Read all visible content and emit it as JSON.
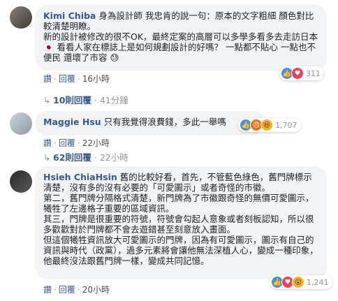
{
  "comments": [
    {
      "author": "Kimi Chiba",
      "text": "身為設計師 我忠肯的說一句：原本的文字粗細 顏色對比較清楚明瞭。\n新的設計被修改的很不OK，最終定案的高層可以多學多看多去走訪日本🇯🇵 看看人家在標誌上是如何規劃設計的好嗎？ 一點都不貼心 一點也不便民 還壞了市容 😓",
      "like": "讚",
      "reply": "回覆",
      "time": "16小時",
      "reaction_count": "311",
      "reactions": [
        "like-emoji",
        "love-emoji"
      ]
    },
    {
      "author": "Maggie Hsu",
      "text": "只有我覺得浪費錢，多此一舉嗎",
      "like": "讚",
      "reply": "回覆",
      "time": "22小時",
      "reaction_count": "1,707",
      "reactions": [
        "like-emoji",
        "angry-emoji",
        "haha-emoji"
      ]
    },
    {
      "author": "Hsieh ChiaHsin",
      "text": "舊的比較好看，首先，不管藍色綠色，舊門牌標示清楚，沒有多的沒有必要的「可愛圖示」或者奇怪的市徽。\n第二，舊門牌分隔格式清楚，新門牌為了市徽跟奇怪的無價可愛圖示，犧牲了左邊格子重要的區域資訊。\n其三，門牌是很重要的符號，符號會勾起人意象或者刻板認知，所以很多歡歡對於門牌都不會去遊錯甚至刻意放入畫面。\n但這個犧牲資訊放大可愛圖示的門牌，因為有可愛圖示，圖示有自己的資訊與時代（政黨），過多元素將會讓他無法深植人心，變成一種印象，他最終沒法跟舊門牌一樣，變成共同記憶。",
      "like": "讚",
      "reply": "回覆",
      "time": "20小時",
      "reaction_count": "1,241",
      "reactions": [
        "like-emoji",
        "love-emoji",
        "wow-emoji"
      ]
    }
  ],
  "reply_threads": [
    {
      "label": "10則回覆",
      "time": "41分鐘"
    },
    {
      "label": "62則回覆",
      "time": "22小時"
    }
  ]
}
